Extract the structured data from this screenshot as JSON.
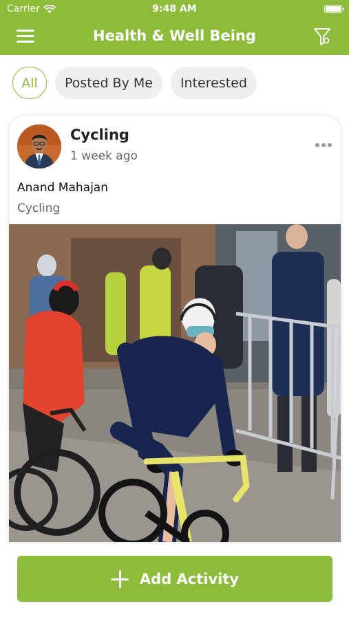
{
  "status_bar": {
    "carrier": "Carrier",
    "time": "9:48 AM"
  },
  "nav": {
    "title": "Health & Well Being",
    "menu_icon": "hamburger-menu-icon",
    "filter_icon": "filter-icon"
  },
  "tabs": [
    {
      "label": "All",
      "active": true
    },
    {
      "label": "Posted By Me",
      "active": false
    },
    {
      "label": "Interested",
      "active": false
    }
  ],
  "post": {
    "title": "Cycling",
    "time_ago": "1 week ago",
    "author": "Anand Mahajan",
    "activity": "Cycling",
    "more_icon": "more-horizontal-icon",
    "image": "cycling-race-photo"
  },
  "add_button": {
    "label": "Add Activity",
    "icon": "plus-icon"
  },
  "colors": {
    "accent": "#8dbc3a",
    "background": "#ffffff",
    "tab_inactive": "#efefef"
  }
}
